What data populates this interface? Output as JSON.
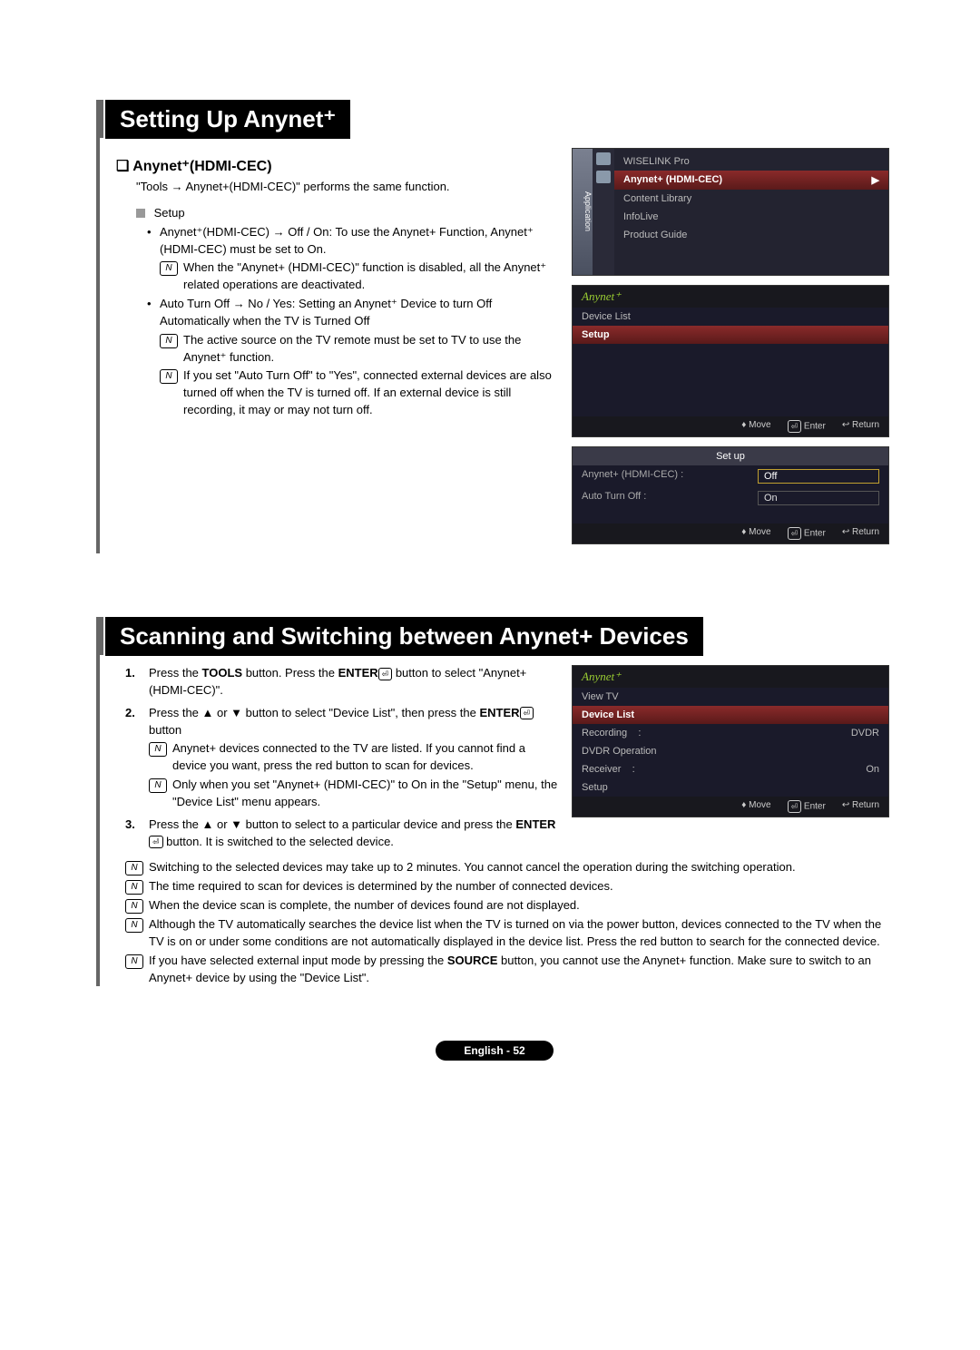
{
  "section1": {
    "title": "Setting Up Anynet⁺",
    "subhead": "Anynet⁺(HDMI-CEC)",
    "intro": "\"Tools → Anynet+(HDMI-CEC)\" performs the same function.",
    "setup_label": "Setup",
    "bullet1": "Anynet⁺(HDMI-CEC) → Off / On: To use the Anynet+ Function, Anynet⁺ (HDMI-CEC) must be set to On.",
    "note1": "When the \"Anynet+ (HDMI-CEC)\" function is disabled, all the Anynet⁺ related operations are deactivated.",
    "bullet2": "Auto Turn Off → No / Yes: Setting an Anynet⁺ Device to turn Off Automatically when the TV is Turned Off",
    "note2": "The active source on the TV remote must be set to TV to use the Anynet⁺ function.",
    "note3": "If you set \"Auto Turn Off\" to \"Yes\", connected external devices are also turned off when the TV is turned off. If an external device is still recording, it may or may not turn off."
  },
  "tv1": {
    "side_tab": "Application",
    "items": [
      "WISELINK Pro",
      "Anynet+ (HDMI-CEC)",
      "Content Library",
      "InfoLive",
      "Product Guide"
    ],
    "arrow": "▶"
  },
  "tv2": {
    "brand": "Anynet⁺",
    "items": [
      "Device List",
      "Setup"
    ],
    "hint_move": "Move",
    "hint_enter": "Enter",
    "hint_return": "Return",
    "move_sym": "♦",
    "enter_sym": "⏎",
    "return_sym": "↩"
  },
  "tv3": {
    "header": "Set up",
    "row1_label": "Anynet+ (HDMI-CEC)",
    "row1_sep": ":",
    "row1_value": "Off",
    "row2_label": "Auto Turn Off",
    "row2_sep": ":",
    "row2_value": "On",
    "hint_move": "Move",
    "hint_enter": "Enter",
    "hint_return": "Return",
    "move_sym": "♦",
    "enter_sym": "⏎",
    "return_sym": "↩"
  },
  "section2": {
    "title": "Scanning and Switching between Anynet+ Devices",
    "step1_a": "Press the ",
    "step1_b": "TOOLS",
    "step1_c": " button. Press the ",
    "step1_d": "ENTER",
    "step1_e": " button to select \"Anynet+ (HDMI-CEC)\".",
    "step2_a": "Press the ▲ or ▼ button to select \"Device List\", then press the ",
    "step2_b": "ENTER",
    "step2_c": " button",
    "step2_note1": "Anynet+ devices connected to the TV are listed. If you cannot find a device you want, press the red button to scan for devices.",
    "step2_note2": "Only when you set \"Anynet+ (HDMI-CEC)\" to On in the \"Setup\" menu, the \"Device List\" menu appears.",
    "step3_a": "Press the ▲ or ▼ button to select to a particular device and press the ",
    "step3_b": "ENTER",
    "step3_c": " button. It is switched to the selected device.",
    "fnote1": "Switching to the selected devices may take up to 2 minutes. You cannot cancel the operation during the switching operation.",
    "fnote2": "The time required to scan for devices is determined by the number of connected devices.",
    "fnote3": "When the device scan is complete, the number of devices found are not displayed.",
    "fnote4": "Although the TV automatically searches the device list when the TV is turned on via the power button, devices connected to the TV when the TV is on or under some conditions are not automatically displayed in the device list. Press the red button to search for the connected device.",
    "fnote5_a": "If you have selected external input mode by pressing the ",
    "fnote5_b": "SOURCE",
    "fnote5_c": " button, you cannot use the Anynet+ function. Make sure to switch to an Anynet+ device by using the \"Device List\"."
  },
  "tv4": {
    "brand": "Anynet⁺",
    "rows": {
      "r0": {
        "label": "View TV",
        "value": ""
      },
      "r1": {
        "label": "Device List",
        "value": ""
      },
      "r2": {
        "label": "Recording",
        "sep": ":",
        "value": "DVDR"
      },
      "r3": {
        "label": "DVDR Operation",
        "value": ""
      },
      "r4": {
        "label": "Receiver",
        "sep": ":",
        "value": "On"
      },
      "r5": {
        "label": "Setup",
        "value": ""
      }
    },
    "hint_move": "Move",
    "hint_enter": "Enter",
    "hint_return": "Return",
    "move_sym": "♦",
    "enter_sym": "⏎",
    "return_sym": "↩"
  },
  "footer": "English - 52",
  "icons": {
    "note": "N",
    "enter": "⏎"
  }
}
